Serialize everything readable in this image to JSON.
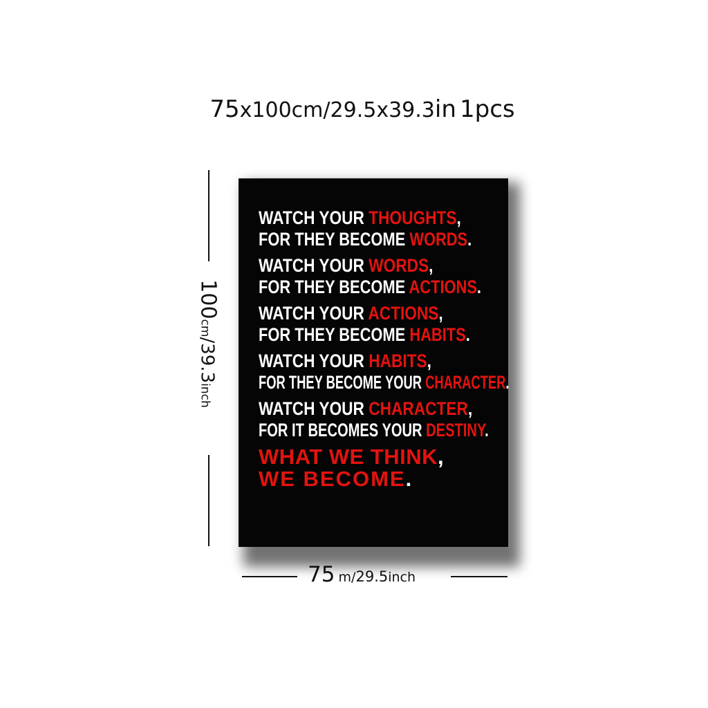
{
  "size_title": {
    "w": "75",
    "x1": "x",
    "h_unit": "100cm",
    "sep": "/",
    "w_in": "29.5",
    "x2": "x",
    "h_in": "39.3",
    "in": "in",
    "count": "1",
    "pcs": "pcs"
  },
  "vertical_dim": {
    "value": "100",
    "unit": "cm",
    "slash": "/",
    "inch_value": "39.3",
    "inch_unit": "inch"
  },
  "horizontal_dim": {
    "value": "75",
    "unit": "m/",
    "inch_value": "29.5",
    "inch_unit": "inch"
  },
  "poster": {
    "verses": [
      {
        "l1_a": "WATCH YOUR ",
        "l1_r": "THOUGHTS",
        "l1_p": ",",
        "l2_a": "FOR THEY BECOME ",
        "l2_r": "WORDS",
        "l2_p": "."
      },
      {
        "l1_a": "WATCH  YOUR  ",
        "l1_r": "WORDS",
        "l1_p": ",",
        "l2_a": "FOR THEY BECOME ",
        "l2_r": "ACTIONS",
        "l2_p": "."
      },
      {
        "l1_a": "WATCH YOUR ",
        "l1_r": "ACTIONS",
        "l1_p": ",",
        "l2_a": "FOR THEY BECOME ",
        "l2_r": "HABITS",
        "l2_p": "."
      },
      {
        "l1_a": "WATCH YOUR ",
        "l1_r": "HABITS",
        "l1_p": ",",
        "l2_a": "FOR THEY BECOME YOUR ",
        "l2_r": "CHARACTER",
        "l2_p": "."
      },
      {
        "l1_a": "WATCH YOUR ",
        "l1_r": "CHARACTER",
        "l1_p": ",",
        "l2_a": "FOR IT BECOMES YOUR ",
        "l2_r": "DESTINY",
        "l2_p": "."
      }
    ],
    "final": {
      "line1": "WHAT WE THINK",
      "line1_p": ",",
      "line2": "WE BECOME",
      "line2_p": "."
    },
    "colors": {
      "background": "#050505",
      "text": "#ffffff",
      "accent": "#e3130f"
    }
  }
}
